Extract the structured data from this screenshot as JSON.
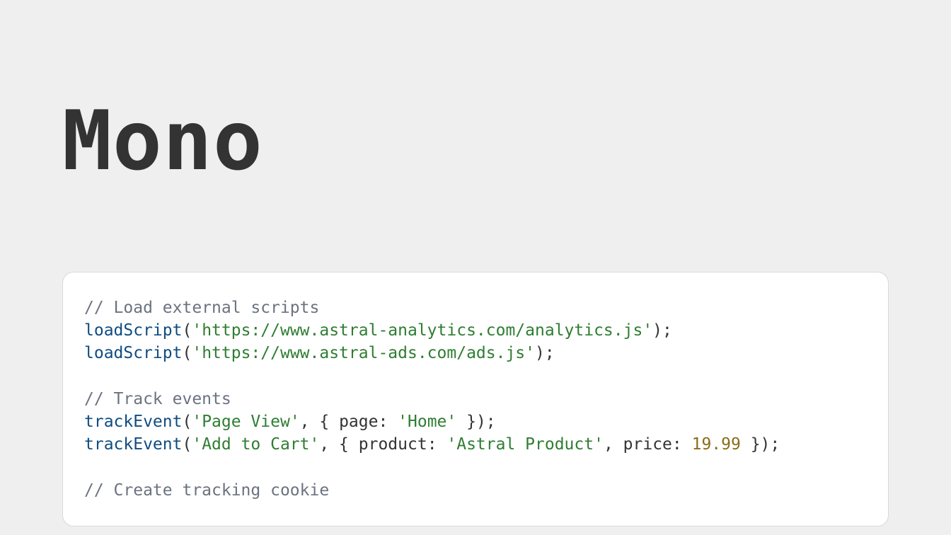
{
  "heading": "Mono",
  "code": {
    "tokens": [
      {
        "cls": "tok-comment",
        "text": "// Load external scripts"
      },
      {
        "cls": "br"
      },
      {
        "cls": "tok-call",
        "text": "loadScript"
      },
      {
        "cls": "tok-punct",
        "text": "("
      },
      {
        "cls": "tok-string",
        "text": "'https://www.astral-analytics.com/analytics.js'"
      },
      {
        "cls": "tok-punct",
        "text": ");"
      },
      {
        "cls": "br"
      },
      {
        "cls": "tok-call",
        "text": "loadScript"
      },
      {
        "cls": "tok-punct",
        "text": "("
      },
      {
        "cls": "tok-string",
        "text": "'https://www.astral-ads.com/ads.js'"
      },
      {
        "cls": "tok-punct",
        "text": ");"
      },
      {
        "cls": "br"
      },
      {
        "cls": "br"
      },
      {
        "cls": "tok-comment",
        "text": "// Track events"
      },
      {
        "cls": "br"
      },
      {
        "cls": "tok-call",
        "text": "trackEvent"
      },
      {
        "cls": "tok-punct",
        "text": "("
      },
      {
        "cls": "tok-string",
        "text": "'Page View'"
      },
      {
        "cls": "tok-punct",
        "text": ", { "
      },
      {
        "cls": "tok-prop",
        "text": "page"
      },
      {
        "cls": "tok-punct",
        "text": ": "
      },
      {
        "cls": "tok-string",
        "text": "'Home'"
      },
      {
        "cls": "tok-punct",
        "text": " });"
      },
      {
        "cls": "br"
      },
      {
        "cls": "tok-call",
        "text": "trackEvent"
      },
      {
        "cls": "tok-punct",
        "text": "("
      },
      {
        "cls": "tok-string",
        "text": "'Add to Cart'"
      },
      {
        "cls": "tok-punct",
        "text": ", { "
      },
      {
        "cls": "tok-prop",
        "text": "product"
      },
      {
        "cls": "tok-punct",
        "text": ": "
      },
      {
        "cls": "tok-string",
        "text": "'Astral Product'"
      },
      {
        "cls": "tok-punct",
        "text": ", "
      },
      {
        "cls": "tok-prop",
        "text": "price"
      },
      {
        "cls": "tok-punct",
        "text": ": "
      },
      {
        "cls": "tok-number",
        "text": "19.99"
      },
      {
        "cls": "tok-punct",
        "text": " });"
      },
      {
        "cls": "br"
      },
      {
        "cls": "br"
      },
      {
        "cls": "tok-comment",
        "text": "// Create tracking cookie"
      }
    ]
  }
}
